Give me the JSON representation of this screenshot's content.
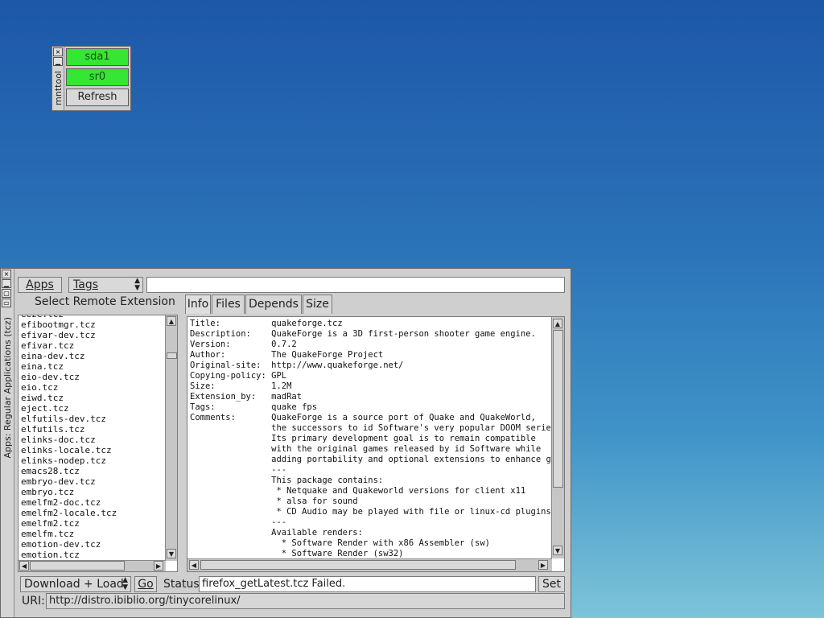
{
  "mount_tool": {
    "title": "mnttool",
    "close_glyph": "×",
    "buttons": [
      {
        "label": "sda1",
        "state": "mounted",
        "color": "#35e635"
      },
      {
        "label": "sr0",
        "state": "mounted",
        "color": "#35e635"
      },
      {
        "label": "Refresh"
      }
    ]
  },
  "apps_window": {
    "title": "Apps: Regular Applications (tcz)",
    "close_glyph": "×",
    "toolbar": {
      "apps_menu": "Apps",
      "tags_select": "Tags",
      "search_value": ""
    },
    "list_header": "Select Remote Extension",
    "extensions": [
      "eeze.tcz",
      "efibootmgr.tcz",
      "efivar-dev.tcz",
      "efivar.tcz",
      "eina-dev.tcz",
      "eina.tcz",
      "eio-dev.tcz",
      "eio.tcz",
      "eiwd.tcz",
      "eject.tcz",
      "elfutils-dev.tcz",
      "elfutils.tcz",
      "elinks-doc.tcz",
      "elinks-locale.tcz",
      "elinks-nodep.tcz",
      "emacs28.tcz",
      "embryo-dev.tcz",
      "embryo.tcz",
      "emelfm2-doc.tcz",
      "emelfm2-locale.tcz",
      "emelfm2.tcz",
      "emelfm.tcz",
      "emotion-dev.tcz",
      "emotion.tcz"
    ],
    "tabs": [
      "Info",
      "Files",
      "Depends",
      "Size"
    ],
    "active_tab": "Info",
    "info_text": "Title:          quakeforge.tcz\nDescription:    QuakeForge is a 3D first-person shooter game engine.\nVersion:        0.7.2\nAuthor:         The QuakeForge Project\nOriginal-site:  http://www.quakeforge.net/\nCopying-policy: GPL\nSize:           1.2M\nExtension_by:   madRat\nTags:           quake fps\nComments:       QuakeForge is a source port of Quake and QuakeWorld,\n                the successors to id Software's very popular DOOM series.\n                Its primary development goal is to remain compatible\n                with the original games released by id Software while\n                adding portability and optional extensions to enhance game\n                ---\n                This package contains:\n                 * Netquake and Quakeworld versions for client x11\n                 * alsa for sound\n                 * CD Audio may be played with file or linux-cd plugins\n                ---\n                Available renders:\n                  * Software Render with x86 Assembler (sw)\n                  * Software Render (sw32)",
    "bottom": {
      "mode_select": "Download + Load",
      "go_button": "Go",
      "status_label": "Status",
      "status_value": "firefox_getLatest.tcz Failed.",
      "set_button": "Set",
      "uri_label": "URI:",
      "uri_value": "http://distro.ibiblio.org/tinycorelinux/"
    }
  }
}
